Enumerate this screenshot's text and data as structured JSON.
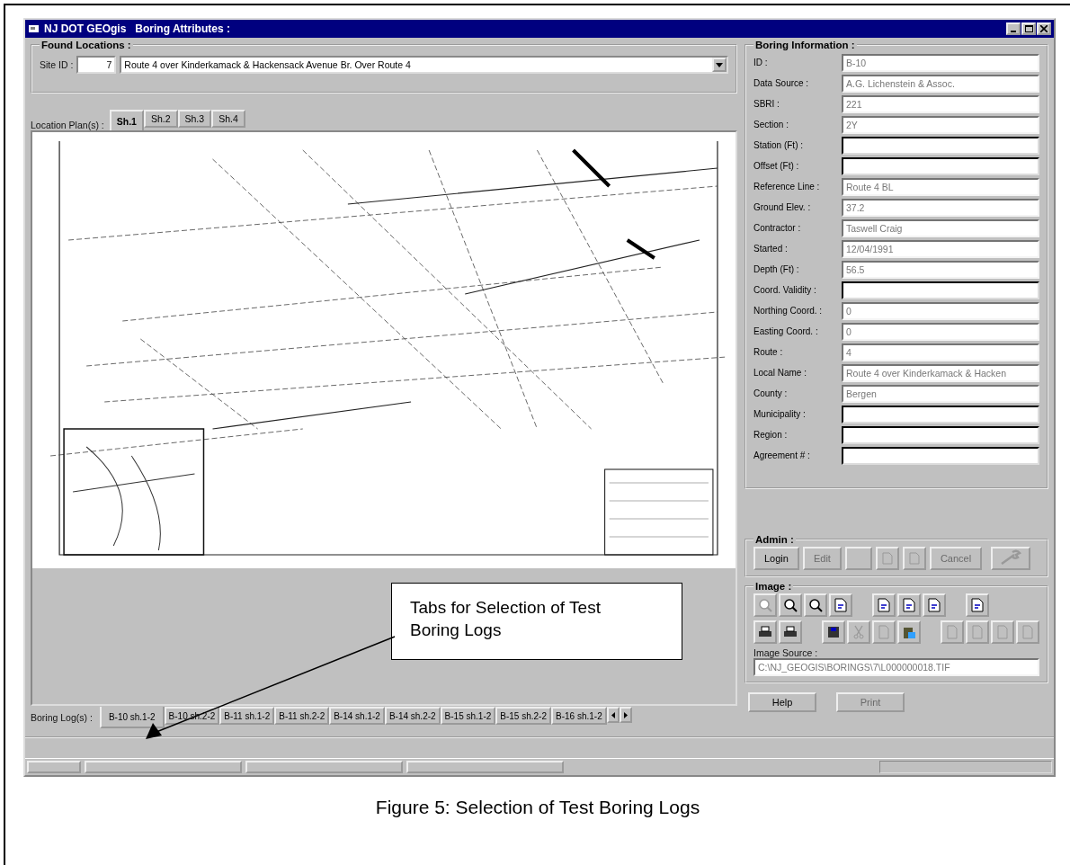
{
  "window": {
    "title": "NJ DOT GEOgis   Boring Attributes :"
  },
  "found_locations": {
    "title": "Found Locations :",
    "site_id_label": "Site ID :",
    "site_id": "7",
    "site_name": "Route 4 over Kinderkamack & Hackensack Avenue Br. Over Route 4"
  },
  "location_plans": {
    "label": "Location Plan(s) :",
    "tabs": [
      {
        "label": "Sh.1",
        "selected": true
      },
      {
        "label": "Sh.2",
        "selected": false
      },
      {
        "label": "Sh.3",
        "selected": false
      },
      {
        "label": "Sh.4",
        "selected": false
      }
    ]
  },
  "boring_information": {
    "title": "Boring Information :",
    "fields": [
      {
        "label": "ID :",
        "value": "B-10",
        "disabled": true
      },
      {
        "label": "Data Source :",
        "value": "A.G. Lichenstein & Assoc.",
        "disabled": true
      },
      {
        "label": "SBRI :",
        "value": "221",
        "disabled": true
      },
      {
        "label": "Section :",
        "value": "2Y",
        "disabled": true
      },
      {
        "label": "Station (Ft) :",
        "disabled": false
      },
      {
        "label": "Offset (Ft) :",
        "disabled": false
      },
      {
        "label": "Reference Line :",
        "value": "Route 4 BL",
        "disabled": true
      },
      {
        "label": "Ground Elev. :",
        "value": "37.2",
        "disabled": true
      },
      {
        "label": "Contractor :",
        "value": "Taswell Craig",
        "disabled": true
      },
      {
        "label": "Started :",
        "value": "12/04/1991",
        "disabled": true
      },
      {
        "label": "Depth (Ft) :",
        "value": "56.5",
        "disabled": true
      },
      {
        "label": "Coord. Validity :",
        "disabled": false
      },
      {
        "label": "Northing Coord. :",
        "value": "0",
        "disabled": true
      },
      {
        "label": "Easting Coord. :",
        "value": "0",
        "disabled": true
      },
      {
        "label": "Route :",
        "value": "4",
        "disabled": true
      },
      {
        "label": "Local Name :",
        "value": "Route 4 over Kinderkamack & Hacken",
        "disabled": true
      },
      {
        "label": "County :",
        "value": "Bergen",
        "disabled": true
      },
      {
        "label": "Municipality :",
        "disabled": false
      },
      {
        "label": "Region :",
        "disabled": false
      },
      {
        "label": "Agreement # :",
        "disabled": false
      }
    ]
  },
  "admin": {
    "title": "Admin :",
    "buttons": [
      {
        "kind": "text",
        "label": "Login",
        "disabled": false
      },
      {
        "kind": "text",
        "label": "Edit",
        "disabled": true
      },
      {
        "kind": "blank"
      },
      {
        "kind": "page",
        "disabled": true
      },
      {
        "kind": "page",
        "disabled": true
      },
      {
        "kind": "text",
        "label": "Cancel",
        "disabled": true
      },
      {
        "kind": "wrench",
        "disabled": true
      }
    ]
  },
  "image": {
    "title": "Image :",
    "source_label": "Image Source :",
    "source": "C:\\NJ_GEOGIS\\BORINGS\\7\\L000000018.TIF"
  },
  "boring_logs": {
    "label": "Boring Log(s) :",
    "tabs": [
      {
        "label": "B-10 sh.1-2",
        "selected": true
      },
      {
        "label": "B-10 sh.2-2",
        "selected": false
      },
      {
        "label": "B-11 sh.1-2",
        "selected": false
      },
      {
        "label": "B-11 sh.2-2",
        "selected": false
      },
      {
        "label": "B-14 sh.1-2",
        "selected": false
      },
      {
        "label": "B-14 sh.2-2",
        "selected": false
      },
      {
        "label": "B-15 sh.1-2",
        "selected": false
      },
      {
        "label": "B-15 sh.2-2",
        "selected": false
      },
      {
        "label": "B-16 sh.1-2",
        "selected": false
      }
    ]
  },
  "footer_buttons": [
    {
      "label": "Help",
      "disabled": false
    },
    {
      "label": "Print",
      "disabled": true
    }
  ],
  "callout": {
    "text": "Tabs for Selection of Test Boring Logs"
  },
  "caption": "Figure 5: Selection of Test Boring Logs"
}
